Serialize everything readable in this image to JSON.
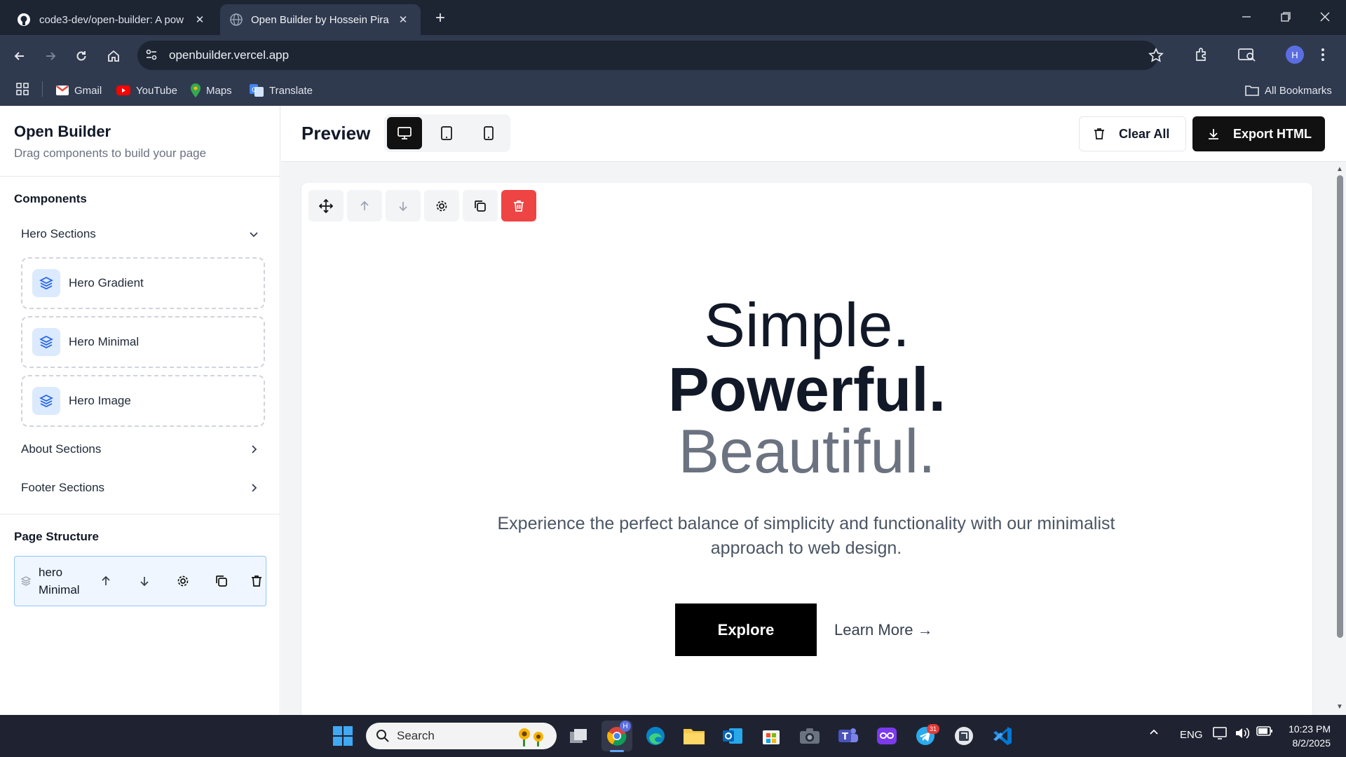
{
  "browser": {
    "tabs": [
      {
        "title": "code3-dev/open-builder: A pow",
        "icon": "github-icon",
        "active": false
      },
      {
        "title": "Open Builder by Hossein Pira",
        "icon": "globe-icon",
        "active": true
      }
    ],
    "url": "openbuilder.vercel.app",
    "profile_initial": "H",
    "bookmarks": [
      {
        "label": "Gmail",
        "icon": "gmail-icon"
      },
      {
        "label": "YouTube",
        "icon": "youtube-icon"
      },
      {
        "label": "Maps",
        "icon": "maps-icon"
      },
      {
        "label": "Translate",
        "icon": "translate-icon"
      }
    ],
    "all_bookmarks": "All Bookmarks"
  },
  "sidebar": {
    "title": "Open Builder",
    "subtitle": "Drag components to build your page",
    "components_heading": "Components",
    "groups": [
      {
        "label": "Hero Sections",
        "expanded": true,
        "items": [
          "Hero Gradient",
          "Hero Minimal",
          "Hero Image"
        ]
      },
      {
        "label": "About Sections",
        "expanded": false
      },
      {
        "label": "Footer Sections",
        "expanded": false
      }
    ],
    "page_structure_heading": "Page Structure",
    "structure_items": [
      {
        "line1": "hero",
        "line2": "Minimal"
      }
    ]
  },
  "main": {
    "preview_title": "Preview",
    "device_modes": [
      "desktop",
      "tablet",
      "mobile"
    ],
    "active_device": "desktop",
    "clear_label": "Clear All",
    "export_label": "Export HTML"
  },
  "hero": {
    "line1": "Simple.",
    "line2": "Powerful.",
    "line3": "Beautiful.",
    "description": "Experience the perfect balance of simplicity and functionality with our minimalist approach to web design.",
    "primary_cta": "Explore",
    "secondary_cta": "Learn More →"
  },
  "taskbar": {
    "search_placeholder": "Search",
    "telegram_badge": "31",
    "chrome_badge": "H",
    "language": "ENG",
    "time": "10:23 PM",
    "date": "8/2/2025"
  },
  "colors": {
    "delete_red": "#ef4444",
    "badge_blue": "#dbeafe",
    "selection_blue": "#93c5fd",
    "hero_dark": "#111827",
    "hero_gray": "#6b7280"
  }
}
